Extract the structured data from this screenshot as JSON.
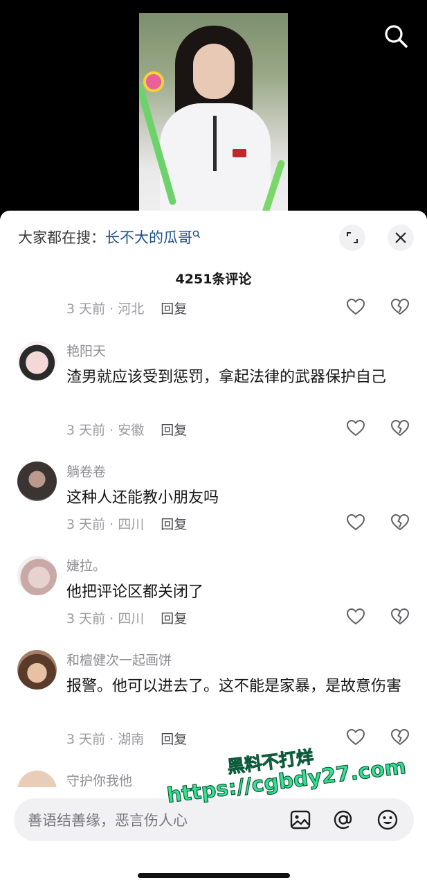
{
  "header": {
    "search_prefix": "大家都在搜：",
    "search_keyword": "长不大的瓜哥",
    "comment_count": "4251条评论"
  },
  "top_partial_row": {
    "meta": "3 天前 · 河北",
    "reply": "回复"
  },
  "comments": [
    {
      "user": "艳阳天",
      "text": "渣男就应该受到惩罚，拿起法律的武器保护自己",
      "meta": "3 天前 · 安徽",
      "reply": "回复"
    },
    {
      "user": "躺卷卷",
      "text": "这种人还能教小朋友吗",
      "meta": "3 天前 · 四川",
      "reply": "回复"
    },
    {
      "user": "婕拉。",
      "text": "他把评论区都关闭了",
      "meta": "3 天前 · 四川",
      "reply": "回复"
    },
    {
      "user": "和檀健次一起画饼",
      "text": "报警。他可以进去了。这不能是家暴，是故意伤害",
      "meta": "3 天前 · 湖南",
      "reply": "回复"
    },
    {
      "user": "守护你我他"
    }
  ],
  "input": {
    "placeholder": "善语结善缘，恶言伤人心"
  },
  "watermark": {
    "line1": "黑料不打烊",
    "line2": "https://cgbdy27.com"
  },
  "colors": {
    "keyword": "#1f4f8a",
    "meta": "#9a9aa0",
    "watermark": "#35e08e"
  }
}
